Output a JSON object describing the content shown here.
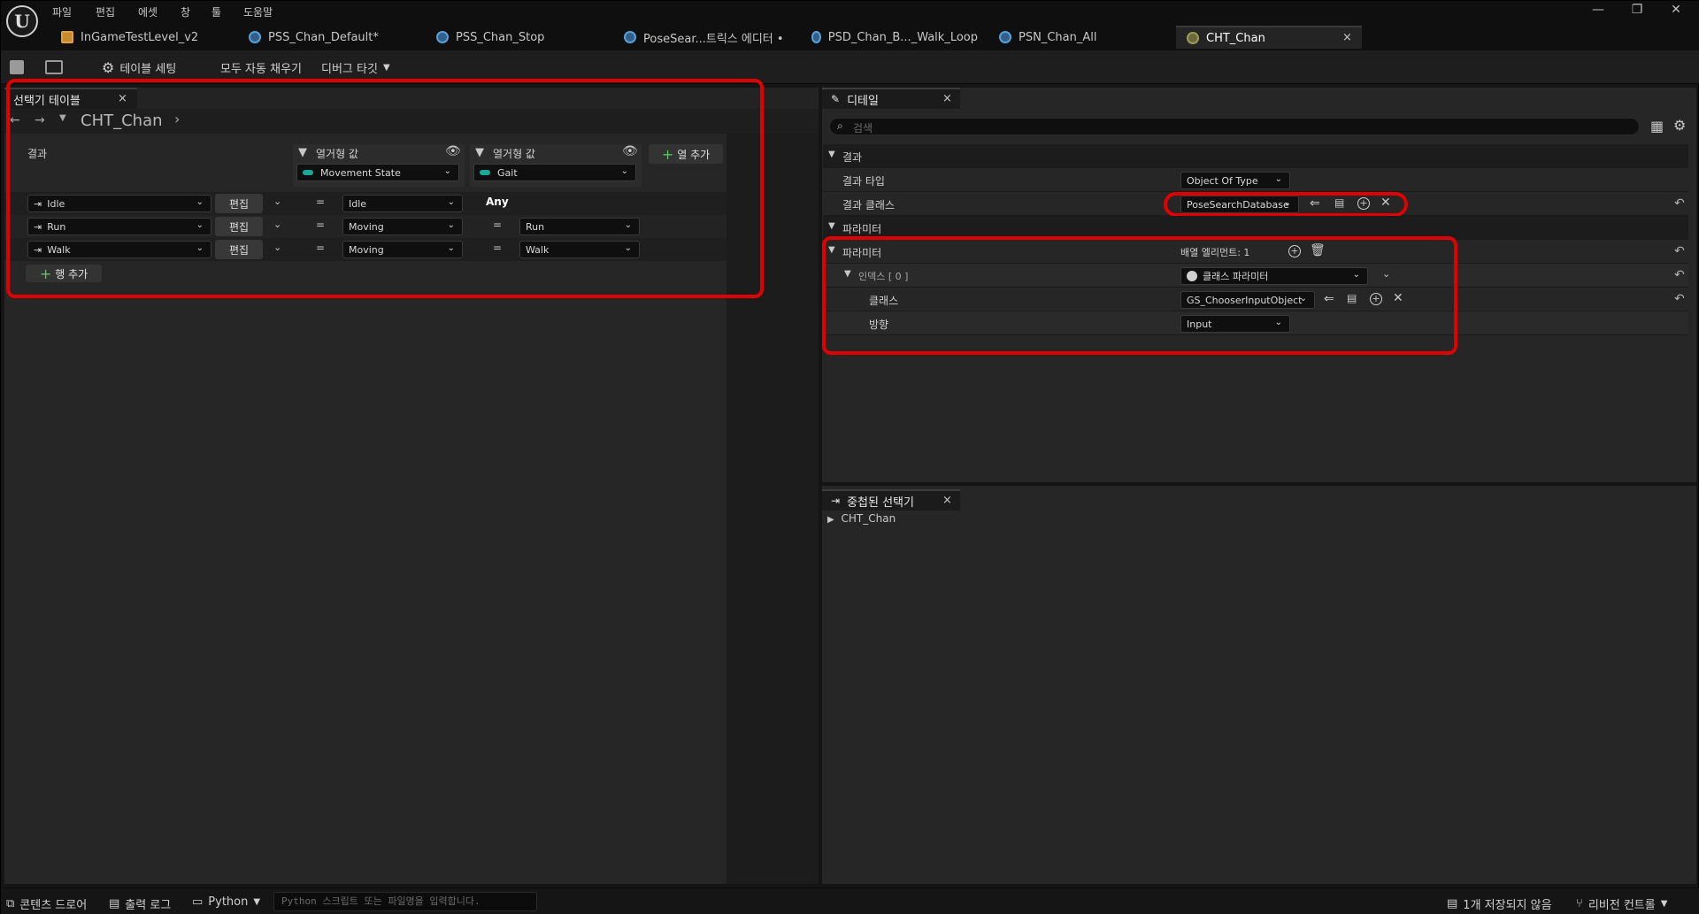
{
  "menu": [
    "파일",
    "편집",
    "에셋",
    "창",
    "툴",
    "도움말"
  ],
  "tabs": [
    {
      "label": "InGameTestLevel_v2",
      "icon": "level-icon"
    },
    {
      "label": "PSS_Chan_Default*",
      "icon": "pose-schema-icon"
    },
    {
      "label": "PSS_Chan_Stop",
      "icon": "pose-schema-icon"
    },
    {
      "label": "PoseSear...트릭스 에디터 •",
      "icon": "pose-search-icon"
    },
    {
      "label": "PSD_Chan_B..._Walk_Loop",
      "icon": "pose-database-icon"
    },
    {
      "label": "PSN_Chan_All",
      "icon": "pose-normalization-icon"
    },
    {
      "label": "CHT_Chan",
      "icon": "chooser-table-icon",
      "close": "×"
    }
  ],
  "toolbar": {
    "table_settings": "테이블 세팅",
    "autofill_all": "모두 자동 채우기",
    "debug_target": "디버그 타깃"
  },
  "chooser_panel": {
    "tab_label": "선택기 테이블",
    "close": "×",
    "breadcrumb": "CHT_Chan",
    "result_header": "결과",
    "columns": [
      {
        "header": "열거형 값",
        "enum": "Movement State"
      },
      {
        "header": "열거형 값",
        "enum": "Gait"
      }
    ],
    "add_column": "열 추가",
    "rows": [
      {
        "result": "Idle",
        "edit": "편집",
        "op1": "=",
        "val1": "Idle",
        "op2": "",
        "val2": "Any"
      },
      {
        "result": "Run",
        "edit": "편집",
        "op1": "=",
        "val1": "Moving",
        "op2": "=",
        "val2": "Run"
      },
      {
        "result": "Walk",
        "edit": "편집",
        "op1": "=",
        "val1": "Moving",
        "op2": "=",
        "val2": "Walk"
      }
    ],
    "add_row": "행 추가"
  },
  "details_panel": {
    "tab_label": "디테일",
    "close": "×",
    "search_placeholder": "검색",
    "section_result": "결과",
    "result_type_label": "결과 타입",
    "result_type_value": "Object Of Type",
    "result_class_label": "결과 클래스",
    "result_class_value": "PoseSearchDatabase",
    "section_params": "파라미터",
    "params_label": "파라미터",
    "array_elements": "배열 엘리먼트: 1",
    "index_label": "인덱스 [ 0 ]",
    "index_value": "클래스 파라미터",
    "class_label": "클래스",
    "class_value": "GS_ChooserInputObject",
    "direction_label": "방향",
    "direction_value": "Input"
  },
  "nested_panel": {
    "tab_label": "중첩된 선택기",
    "close": "×",
    "item": "CHT_Chan"
  },
  "statusbar": {
    "content_drawer": "콘텐츠 드로어",
    "output_log": "출력 로그",
    "python": "Python",
    "python_placeholder": "Python 스크립트 또는 파일명을 입력합니다.",
    "unsaved": "1개 저장되지 않음",
    "revision_control": "리비전 컨트롤"
  },
  "colors": {
    "highlight": "#e00000",
    "enum_accent": "#1aa89a"
  }
}
